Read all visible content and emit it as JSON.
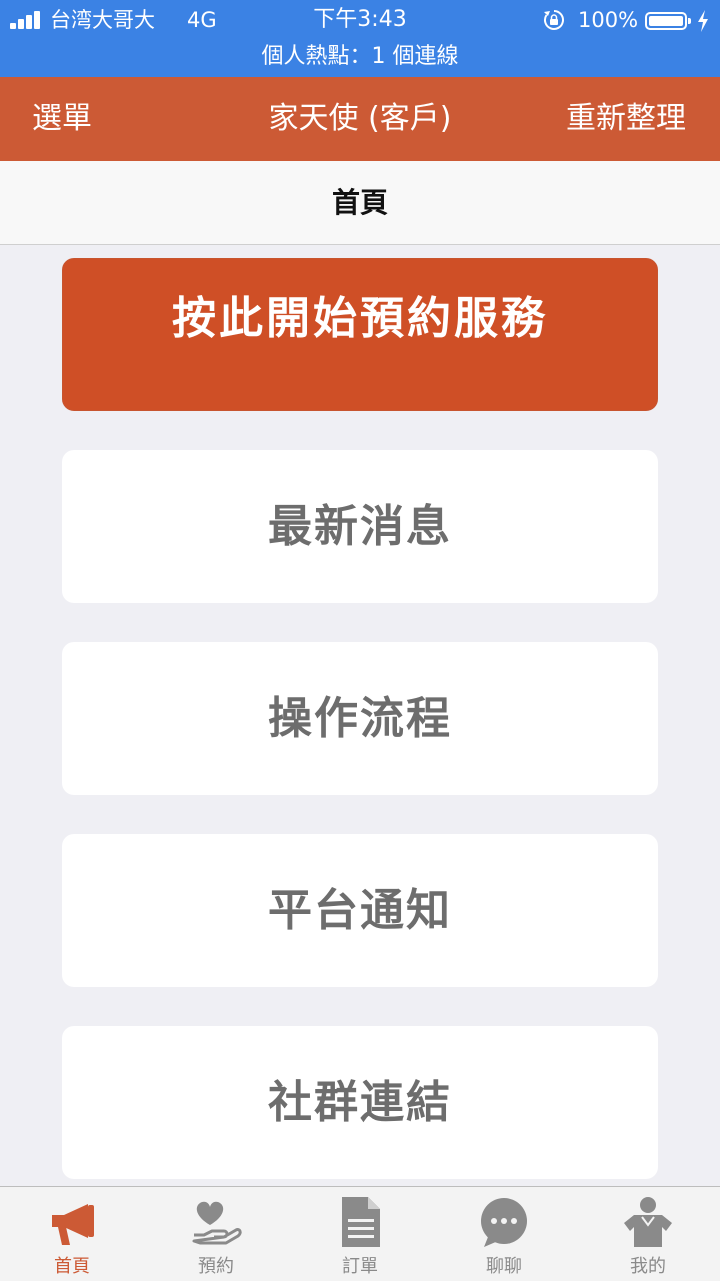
{
  "status_bar": {
    "carrier": "台湾大哥大",
    "network": "4G",
    "time": "下午3:43",
    "battery": "100%",
    "hotspot": "個人熱點：1 個連線"
  },
  "nav": {
    "left": "選單",
    "title": "家天使 (客戶)",
    "right": "重新整理"
  },
  "page_title": "首頁",
  "primary_action": "按此開始預約服務",
  "menu": [
    {
      "label": "最新消息"
    },
    {
      "label": "操作流程"
    },
    {
      "label": "平台通知"
    },
    {
      "label": "社群連結"
    }
  ],
  "tabs": [
    {
      "label": "首頁",
      "icon": "megaphone-icon",
      "active": true
    },
    {
      "label": "預約",
      "icon": "heart-hand-icon"
    },
    {
      "label": "訂單",
      "icon": "document-icon"
    },
    {
      "label": "聊聊",
      "icon": "chat-bubble-icon"
    },
    {
      "label": "我的",
      "icon": "person-icon"
    }
  ],
  "colors": {
    "status_bar": "#3b82e4",
    "accent": "#cc5a35",
    "primary_button": "#cf4f26",
    "inactive_tab": "#8a8a8a"
  }
}
